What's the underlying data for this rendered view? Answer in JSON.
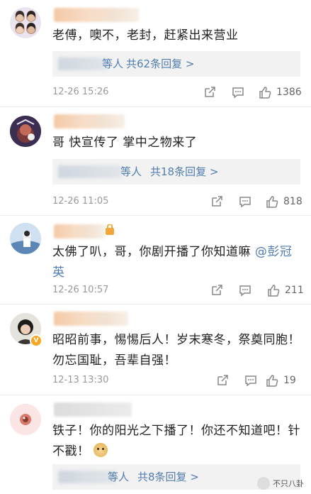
{
  "comments": [
    {
      "text": "老傅，噢不，老封，赶紧出来营业",
      "reply_suffix": "等人",
      "reply_count_text": "共62条回复 >",
      "time": "12-26 15:26",
      "likes": "1386"
    },
    {
      "text": "哥  快宣传了  掌中之物来了",
      "reply_suffix": "等人",
      "reply_count_text": "共18条回复 >",
      "time": "12-26 11:05",
      "likes": "818"
    },
    {
      "text_prefix": "太佛了叭，哥，你剧开播了你知道嘛 ",
      "mention": "@彭冠英",
      "time": "12-26 10:57",
      "likes": "211"
    },
    {
      "text": "昭昭前事，惕惕后人！岁末寒冬，祭奠同胞！ 勿忘国耻，吾辈自强！",
      "time": "12-13 13:30",
      "likes": "19"
    },
    {
      "text": "铁子！你的阳光之下播了！你还不知道吧！针不戳！",
      "reply_suffix": "等人",
      "reply_count_text": "共8条回复 >"
    }
  ],
  "watermark": "不只八卦",
  "colors": {
    "link": "#507daf",
    "meta": "#999999",
    "reply_bg": "#f2f2f2"
  }
}
